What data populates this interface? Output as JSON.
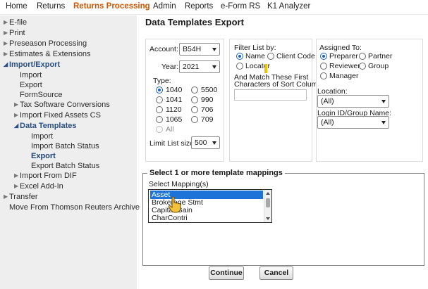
{
  "nav": {
    "items": [
      {
        "label": "Home"
      },
      {
        "label": "Returns"
      },
      {
        "label": "Returns Processing",
        "active": true
      },
      {
        "label": "Admin"
      },
      {
        "label": "Reports"
      },
      {
        "label": "e-Form RS"
      },
      {
        "label": "K1 Analyzer"
      }
    ]
  },
  "sidebar": {
    "items": [
      {
        "label": "E-file"
      },
      {
        "label": "Print"
      },
      {
        "label": "Preseason Processing"
      },
      {
        "label": "Estimates & Extensions"
      },
      {
        "label": "Import/Export"
      },
      {
        "label": "Import"
      },
      {
        "label": "Export"
      },
      {
        "label": "FormSource"
      },
      {
        "label": "Tax Software Conversions"
      },
      {
        "label": "Import Fixed Assets CS"
      },
      {
        "label": "Data Templates"
      },
      {
        "label": "Import"
      },
      {
        "label": "Import Batch Status"
      },
      {
        "label": "Export"
      },
      {
        "label": "Export Batch Status"
      },
      {
        "label": "Import From DIF"
      },
      {
        "label": "Excel Add-In"
      },
      {
        "label": "Transfer"
      },
      {
        "label": "Move From Thomson Reuters Archive"
      }
    ]
  },
  "page": {
    "title": "Data Templates Export"
  },
  "filters": {
    "account_label": "Account:",
    "account_value": "B54H",
    "year_label": "Year:",
    "year_value": "2021",
    "type_label": "Type:",
    "types": [
      {
        "label": "1040",
        "selected": true
      },
      {
        "label": "5500"
      },
      {
        "label": "1041"
      },
      {
        "label": "990"
      },
      {
        "label": "1120"
      },
      {
        "label": "706"
      },
      {
        "label": "1065"
      },
      {
        "label": "709"
      },
      {
        "label": "All"
      }
    ],
    "limit_label": "Limit List size to",
    "limit_value": "500"
  },
  "filter_list": {
    "label": "Filter List by:",
    "options": [
      {
        "label": "Name",
        "selected": true
      },
      {
        "label": "Client Code"
      },
      {
        "label": "Locator"
      }
    ],
    "match_label_line1": "And Match These First",
    "match_label_line2": "Characters of Sort Column:",
    "match_value": ""
  },
  "assigned": {
    "label": "Assigned To:",
    "options": [
      {
        "label": "Preparer",
        "selected": true
      },
      {
        "label": "Partner"
      },
      {
        "label": "Reviewer"
      },
      {
        "label": "Group"
      },
      {
        "label": "Manager"
      }
    ],
    "location_label": "Location:",
    "location_value": "(All)",
    "login_label": "Login ID/Group Name:",
    "login_value": "(All)"
  },
  "mappings": {
    "legend": "Select 1 or more template mappings",
    "select_label": "Select Mapping(s)",
    "items": [
      {
        "label": "Asset",
        "selected": true
      },
      {
        "label": "Brokerage Stmt"
      },
      {
        "label": "Capital Gain"
      },
      {
        "label": "CharContri"
      }
    ]
  },
  "buttons": {
    "continue": "Continue",
    "cancel": "Cancel"
  }
}
